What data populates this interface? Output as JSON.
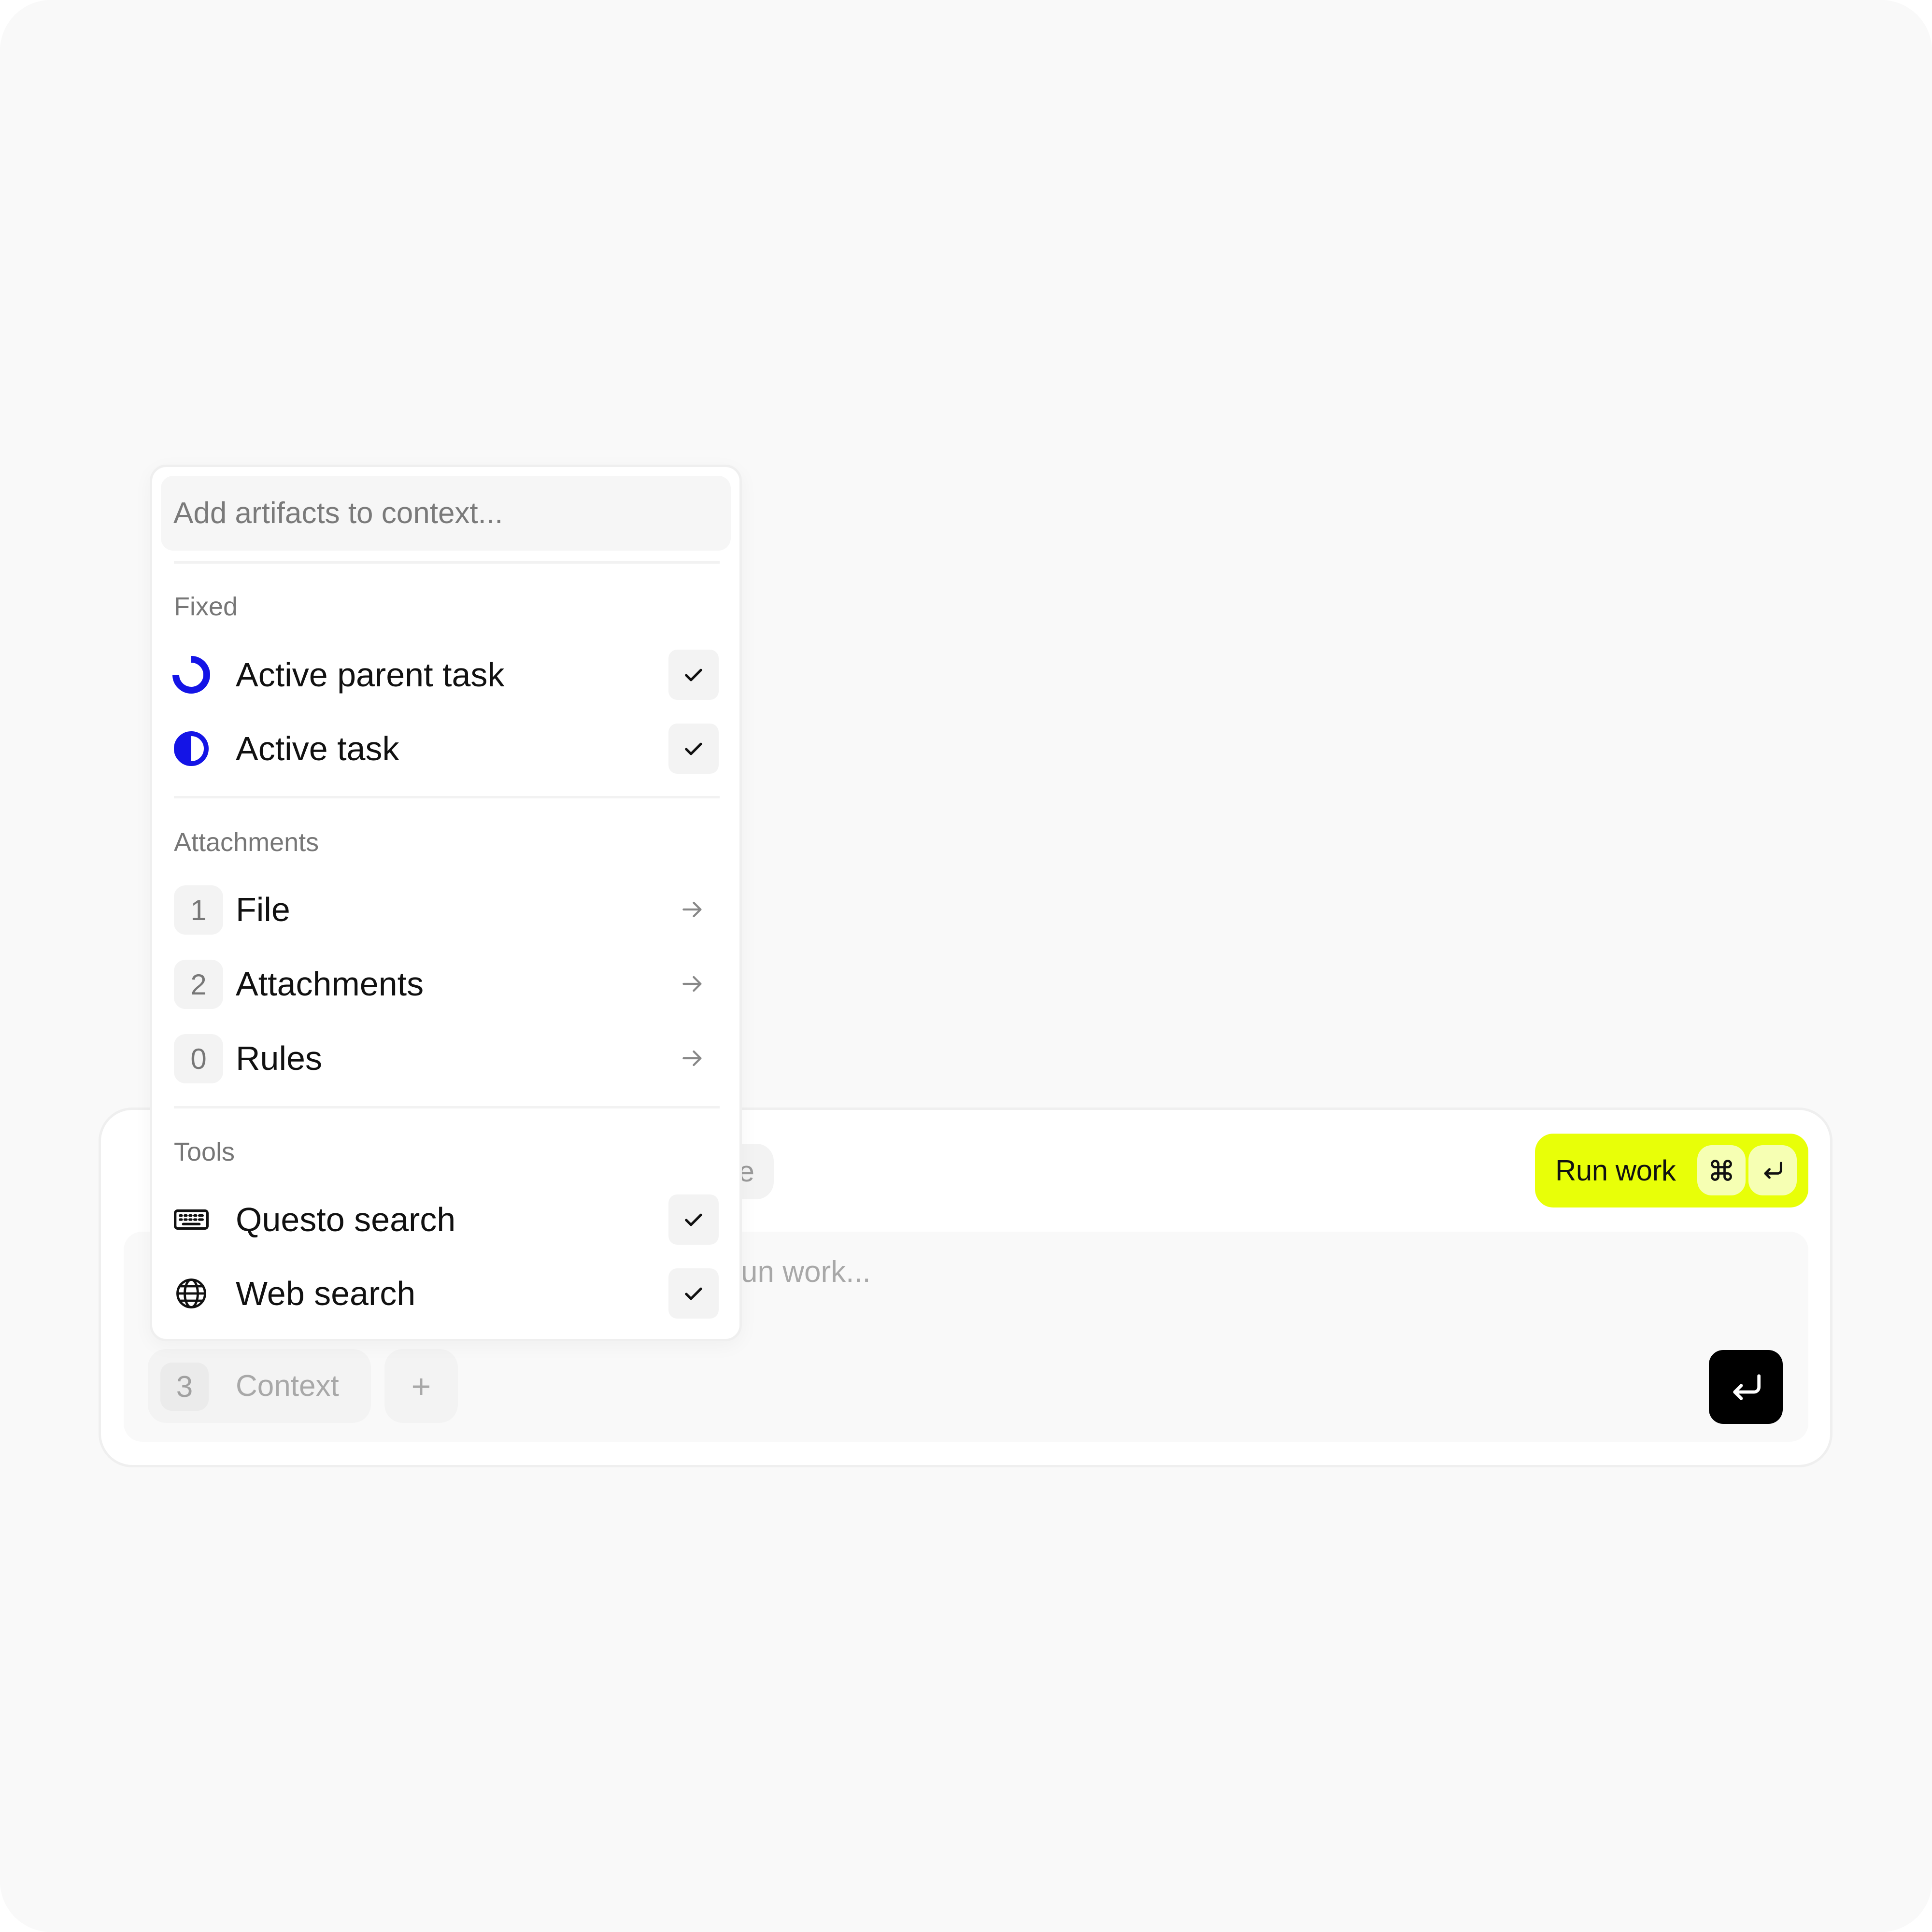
{
  "composer": {
    "run_work_label": "Run work",
    "shortcut_keys": [
      "command-key",
      "return-key"
    ],
    "hidden_chip_text": "e",
    "input_placeholder_visible": "un work...",
    "context_count": "3",
    "context_label": "Context",
    "add_label": "+"
  },
  "popover": {
    "search_placeholder": "Add artifacts to context...",
    "sections": {
      "fixed": {
        "label": "Fixed",
        "items": [
          {
            "label": "Active parent task",
            "icon": "progress-ring-icon",
            "checked": true
          },
          {
            "label": "Active task",
            "icon": "half-circle-icon",
            "checked": true
          }
        ]
      },
      "attachments": {
        "label": "Attachments",
        "items": [
          {
            "count": "1",
            "label": "File"
          },
          {
            "count": "2",
            "label": "Attachments"
          },
          {
            "count": "0",
            "label": "Rules"
          }
        ]
      },
      "tools": {
        "label": "Tools",
        "items": [
          {
            "label": "Questo search",
            "icon": "keyboard-icon",
            "checked": true
          },
          {
            "label": "Web search",
            "icon": "globe-icon",
            "checked": true
          }
        ]
      }
    }
  },
  "colors": {
    "accent_yellow": "#e8ff08",
    "status_blue": "#1414e6",
    "send_button": "#000000"
  }
}
